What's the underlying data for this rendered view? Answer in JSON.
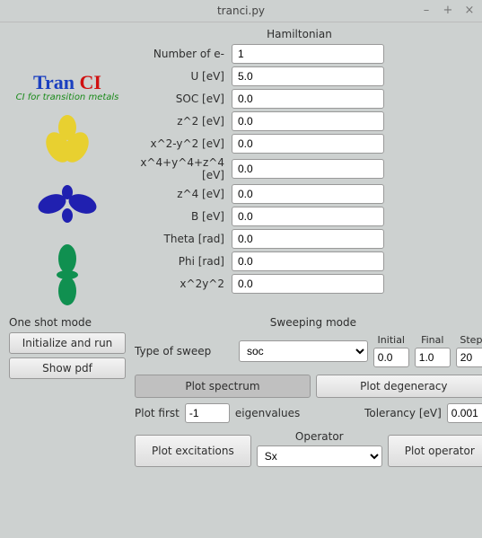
{
  "window": {
    "title": "tranci.py"
  },
  "logo": {
    "brand_left": "Tran ",
    "brand_right": "CI",
    "subtitle": "CI for transition metals"
  },
  "hamiltonian": {
    "title": "Hamiltonian",
    "fields": {
      "n_e": {
        "label": "Number of e-",
        "value": "1"
      },
      "u": {
        "label": "U [eV]",
        "value": "5.0"
      },
      "soc": {
        "label": "SOC [eV]",
        "value": "0.0"
      },
      "z2": {
        "label": "z^2 [eV]",
        "value": "0.0"
      },
      "x2y2": {
        "label": "x^2-y^2 [eV]",
        "value": "0.0"
      },
      "x4y4z4": {
        "label": "x^4+y^4+z^4 [eV]",
        "value": "0.0"
      },
      "z4": {
        "label": "z^4 [eV]",
        "value": "0.0"
      },
      "b": {
        "label": "B [eV]",
        "value": "0.0"
      },
      "theta": {
        "label": "Theta [rad]",
        "value": "0.0"
      },
      "phi": {
        "label": "Phi [rad]",
        "value": "0.0"
      },
      "x2y2b": {
        "label": "x^2y^2",
        "value": "0.0"
      }
    }
  },
  "oneshot": {
    "title": "One shot mode",
    "init_run": "Initialize and run",
    "show_pdf": "Show pdf"
  },
  "sweep": {
    "title": "Sweeping mode",
    "type_label": "Type of sweep",
    "type_value": "soc",
    "initial": {
      "label": "Initial",
      "value": "0.0"
    },
    "final": {
      "label": "Final",
      "value": "1.0"
    },
    "steps": {
      "label": "Steps",
      "value": "20"
    }
  },
  "plots": {
    "spectrum": "Plot spectrum",
    "degeneracy": "Plot degeneracy",
    "plot_first_label": "Plot first",
    "plot_first_value": "-1",
    "eigen_label": "eigenvalues",
    "tolerancy_label": "Tolerancy [eV]",
    "tolerancy_value": "0.001",
    "excitations": "Plot excitations",
    "operator_label": "Operator",
    "operator_value": "Sx",
    "plot_operator": "Plot operator"
  }
}
